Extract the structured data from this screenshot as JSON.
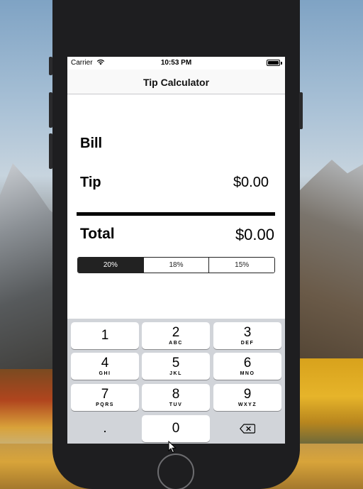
{
  "status_bar": {
    "carrier": "Carrier",
    "time": "10:53 PM"
  },
  "nav": {
    "title": "Tip Calculator"
  },
  "form": {
    "bill_label": "Bill",
    "bill_value": "",
    "tip_label": "Tip",
    "tip_value": "$0.00",
    "total_label": "Total",
    "total_value": "$0.00"
  },
  "tip_options": {
    "segments": [
      "20%",
      "18%",
      "15%"
    ],
    "selected": "20%"
  },
  "keyboard": {
    "keys": [
      {
        "digit": "1",
        "letters": ""
      },
      {
        "digit": "2",
        "letters": "ABC"
      },
      {
        "digit": "3",
        "letters": "DEF"
      },
      {
        "digit": "4",
        "letters": "GHI"
      },
      {
        "digit": "5",
        "letters": "JKL"
      },
      {
        "digit": "6",
        "letters": "MNO"
      },
      {
        "digit": "7",
        "letters": "PQRS"
      },
      {
        "digit": "8",
        "letters": "TUV"
      },
      {
        "digit": "9",
        "letters": "WXYZ"
      }
    ],
    "decimal": ".",
    "zero": "0",
    "backspace_icon": "backspace-icon"
  },
  "colors": {
    "segment_active": "#222222",
    "keyboard_bg": "#d1d4d9"
  }
}
